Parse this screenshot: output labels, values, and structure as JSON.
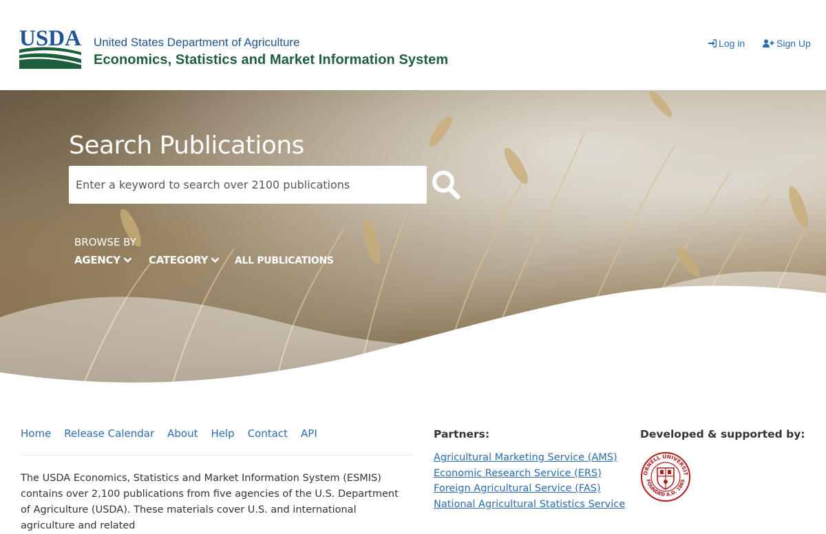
{
  "header": {
    "logo_text": "USDA",
    "agency": "United States Department of Agriculture",
    "system": "Economics, Statistics and Market Information System",
    "login_label": "Log in",
    "signup_label": "Sign Up",
    "login_icon": "sign-in-icon",
    "signup_icon": "user-plus-icon"
  },
  "hero": {
    "title": "Search Publications",
    "search_placeholder": "Enter a keyword to search over 2100 publications",
    "search_icon": "search-icon",
    "browse_label": "BROWSE BY",
    "browse_links": [
      {
        "label": "AGENCY",
        "icon": "chevron-down-icon"
      },
      {
        "label": "CATEGORY",
        "icon": "chevron-down-icon"
      },
      {
        "label": "ALL PUBLICATIONS"
      }
    ]
  },
  "footer": {
    "nav": [
      "Home",
      "Release Calendar",
      "About",
      "Help",
      "Contact",
      "API"
    ],
    "about_text": "The USDA Economics, Statistics and Market Information System (ESMIS) contains over 2,100 publications from five agencies of the U.S. Department of Agriculture (USDA). These materials cover U.S. and international agriculture and related",
    "partners_title": "Partners:",
    "partners": [
      "Agricultural Marketing Service (AMS)",
      "Economic Research Service (ERS)",
      "Foreign Agricultural Service (FAS)",
      "National Agricultural Statistics Service"
    ],
    "developed_title": "Developed & supported by:",
    "seal_text": "CORNELL UNIVERSITY FOUNDED A.D. 1865"
  },
  "colors": {
    "link": "#2b6cb0",
    "usda_blue": "#205493",
    "usda_green": "#1e5e3c",
    "cornell_red": "#b31b1b"
  }
}
